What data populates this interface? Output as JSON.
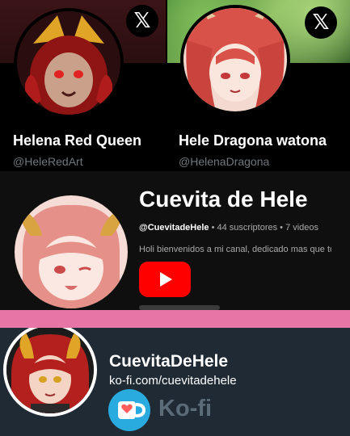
{
  "x_cards": [
    {
      "display_name": "Helena Red Queen",
      "handle": "@HeleRedArt",
      "platform_icon": "x-logo-icon"
    },
    {
      "display_name": "Hele Dragona watona",
      "handle": "@HelenaDragona",
      "platform_icon": "x-logo-icon"
    }
  ],
  "youtube": {
    "channel_name": "Cuevita de Hele",
    "handle": "@CuevitadeHele",
    "meta": "• 44 suscriptores • 7 videos",
    "description": "Holi bienvenidos a mi canal, dedicado mas que toc",
    "logo_icon": "youtube-play-icon"
  },
  "kofi": {
    "name": "CuevitaDeHele",
    "url": "ko-fi.com/cuevitadehele",
    "brand": "Ko-fi",
    "logo_icon": "kofi-cup-icon"
  },
  "colors": {
    "x_background": "#000000",
    "handle_gray": "#71767b",
    "youtube_red": "#ff0000",
    "divider_pink": "#e776a6",
    "kofi_background": "#202a34",
    "kofi_blue": "#29abe0"
  }
}
